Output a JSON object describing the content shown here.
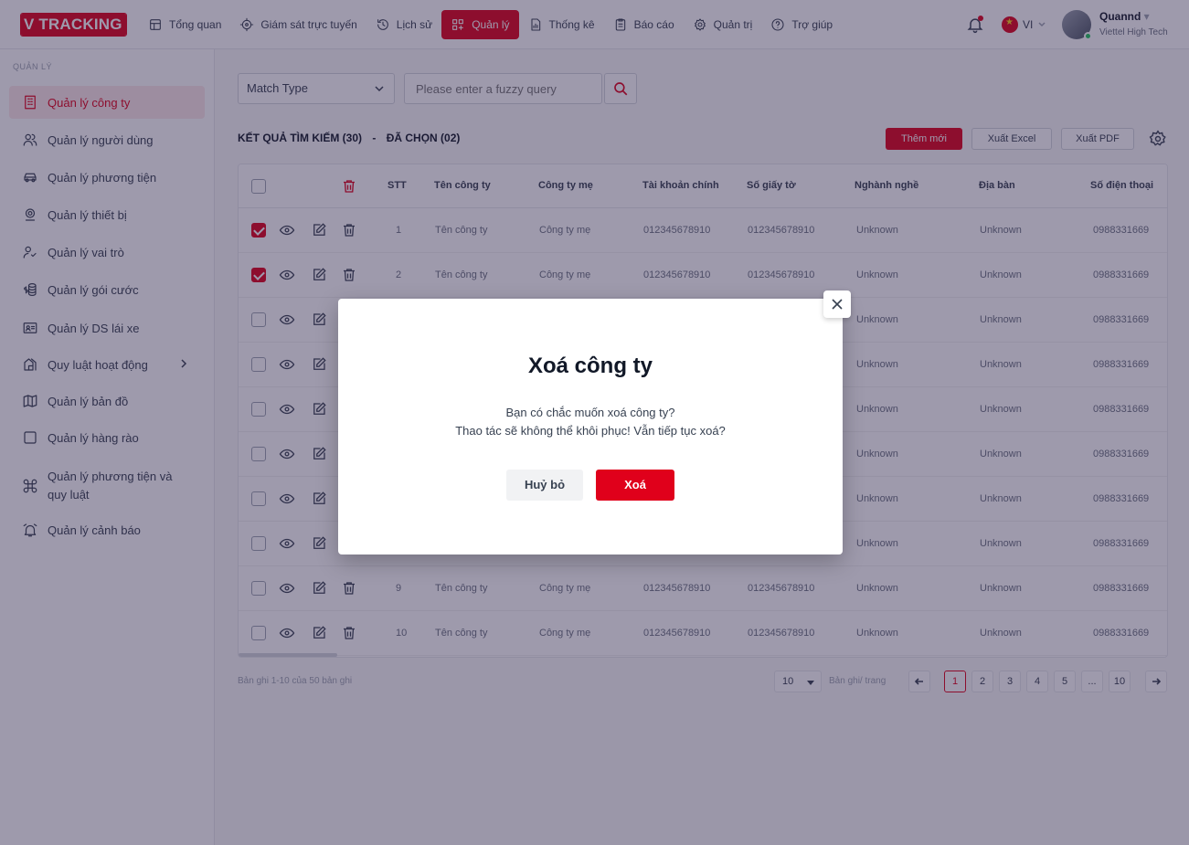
{
  "app": {
    "logo_v": "V",
    "logo_text": "TRACKING"
  },
  "nav": [
    {
      "label": "Tổng quan",
      "icon": "dashboard-icon"
    },
    {
      "label": "Giám sát trực tuyến",
      "icon": "target-icon"
    },
    {
      "label": "Lịch sử",
      "icon": "history-icon"
    },
    {
      "label": "Quản lý",
      "icon": "management-icon",
      "active": true
    },
    {
      "label": "Thống kê",
      "icon": "statistics-icon"
    },
    {
      "label": "Báo cáo",
      "icon": "report-icon"
    },
    {
      "label": "Quản trị",
      "icon": "gear-icon"
    },
    {
      "label": "Trợ giúp",
      "icon": "help-icon"
    }
  ],
  "header": {
    "lang": "VI",
    "user_name": "Quannd",
    "user_org": "Viettel High Tech"
  },
  "sidebar": {
    "section": "QUẢN LÝ",
    "items": [
      {
        "label": "Quản lý công ty",
        "icon": "building-icon",
        "active": true
      },
      {
        "label": "Quản lý người dùng",
        "icon": "users-icon"
      },
      {
        "label": "Quản lý phương tiện",
        "icon": "car-icon"
      },
      {
        "label": "Quản lý thiết bị",
        "icon": "device-icon"
      },
      {
        "label": "Quản lý vai trò",
        "icon": "user-check-icon"
      },
      {
        "label": "Quản lý gói cước",
        "icon": "coins-icon"
      },
      {
        "label": "Quản lý DS lái xe",
        "icon": "id-card-icon"
      },
      {
        "label": "Quy luật hoạt động",
        "icon": "rules-icon"
      },
      {
        "label": "Quản lý bản đồ",
        "icon": "map-icon"
      },
      {
        "label": "Quản lý hàng rào",
        "icon": "fence-icon"
      },
      {
        "label": "Quản lý phương tiện và",
        "label2": "quy luật",
        "icon": "command-icon"
      },
      {
        "label": "Quản lý cảnh báo",
        "icon": "alarm-icon"
      }
    ]
  },
  "filter": {
    "match_type": "Match Type",
    "search_placeholder": "Please enter a fuzzy query"
  },
  "results": {
    "found": "KẾT QUẢ TÌM KIẾM (30)",
    "sep": "-",
    "selected": "ĐÃ CHỌN (02)"
  },
  "actions": {
    "add": "Thêm mới",
    "excel": "Xuất Excel",
    "pdf": "Xuất PDF"
  },
  "table": {
    "headers": [
      "STT",
      "Tên công ty",
      "Công ty mẹ",
      "Tài khoản chính",
      "Số giấy tờ",
      "Nghành nghề",
      "Địa bàn",
      "Số điện thoại"
    ],
    "rows": [
      {
        "stt": "1",
        "name": "Tên công ty",
        "parent": "Công ty mẹ",
        "account": "012345678910",
        "doc": "012345678910",
        "industry": "Unknown",
        "area": "Unknown",
        "phone": "0988331669",
        "checked": true,
        "partial": false
      },
      {
        "stt": "2",
        "name": "Tên công ty",
        "parent": "Công ty mẹ",
        "account": "012345678910",
        "doc": "012345678910",
        "industry": "Unknown",
        "area": "Unknown",
        "phone": "0988331669",
        "checked": true,
        "partial": false
      },
      {
        "stt": "",
        "name": "",
        "parent": "",
        "account": "",
        "doc": "",
        "industry": "Unknown",
        "area": "Unknown",
        "phone": "0988331669",
        "checked": false,
        "partial": true
      },
      {
        "stt": "",
        "name": "",
        "parent": "",
        "account": "",
        "doc": "",
        "industry": "Unknown",
        "area": "Unknown",
        "phone": "0988331669",
        "checked": false,
        "partial": true
      },
      {
        "stt": "",
        "name": "",
        "parent": "",
        "account": "",
        "doc": "",
        "industry": "Unknown",
        "area": "Unknown",
        "phone": "0988331669",
        "checked": false,
        "partial": true
      },
      {
        "stt": "",
        "name": "",
        "parent": "",
        "account": "",
        "doc": "",
        "industry": "Unknown",
        "area": "Unknown",
        "phone": "0988331669",
        "checked": false,
        "partial": true
      },
      {
        "stt": "",
        "name": "",
        "parent": "",
        "account": "",
        "doc": "",
        "industry": "Unknown",
        "area": "Unknown",
        "phone": "0988331669",
        "checked": false,
        "partial": true
      },
      {
        "stt": "",
        "name": "",
        "parent": "",
        "account": "",
        "doc": "",
        "industry": "Unknown",
        "area": "Unknown",
        "phone": "0988331669",
        "checked": false,
        "partial": true
      },
      {
        "stt": "9",
        "name": "Tên công ty",
        "parent": "Công ty mẹ",
        "account": "012345678910",
        "doc": "012345678910",
        "industry": "Unknown",
        "area": "Unknown",
        "phone": "0988331669",
        "checked": false,
        "partial": false
      },
      {
        "stt": "10",
        "name": "Tên công ty",
        "parent": "Công ty mẹ",
        "account": "012345678910",
        "doc": "012345678910",
        "industry": "Unknown",
        "area": "Unknown",
        "phone": "0988331669",
        "checked": false,
        "partial": false
      }
    ]
  },
  "pagination": {
    "info": "Bản ghi 1-10 của 50 bản ghi",
    "page_size": "10",
    "per_page_label": "Bản ghi/ trang",
    "pages": [
      "1",
      "2",
      "3",
      "4",
      "5",
      "...",
      "10"
    ],
    "current": "1"
  },
  "modal": {
    "title": "Xoá công ty",
    "line1": "Bạn có chắc muốn xoá công ty?",
    "line2": "Thao tác sẽ không thể khôi phục! Vẫn tiếp tục xoá?",
    "cancel": "Huỷ bỏ",
    "confirm": "Xoá"
  },
  "colors": {
    "accent": "#e0001b",
    "overlay": "rgba(40,30,70,0.45)"
  }
}
